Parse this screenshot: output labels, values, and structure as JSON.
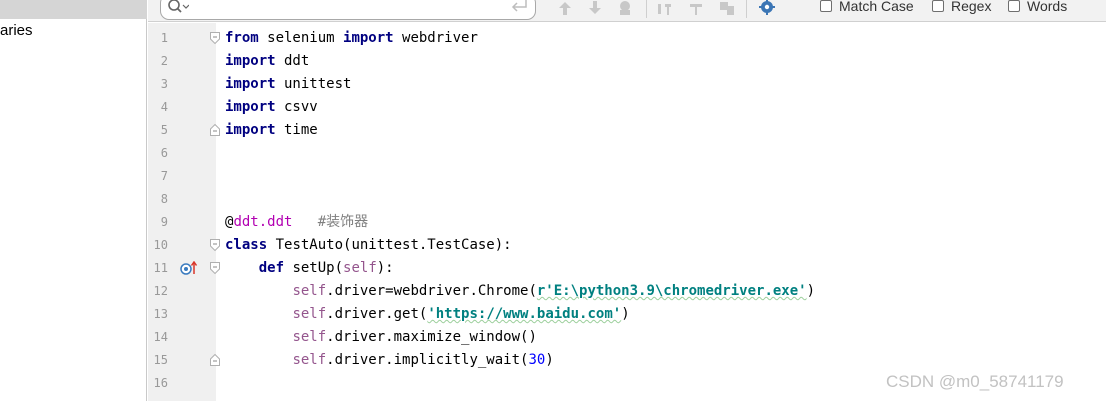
{
  "project": {
    "tree_label": "aries"
  },
  "find": {
    "search_value": "",
    "options": [
      {
        "label": "Match Case",
        "checked": false
      },
      {
        "label": "Regex",
        "checked": false
      },
      {
        "label": "Words",
        "checked": false
      }
    ]
  },
  "editor": {
    "line_numbers": [
      "1",
      "2",
      "3",
      "4",
      "5",
      "6",
      "7",
      "8",
      "9",
      "10",
      "11",
      "12",
      "13",
      "14",
      "15",
      "16"
    ],
    "code": {
      "l1_kw1": "from",
      "l1_mod": " selenium ",
      "l1_kw2": "import",
      "l1_name": " webdriver",
      "l2_kw": "import",
      "l2_name": " ddt",
      "l3_kw": "import",
      "l3_name": " unittest",
      "l4_kw": "import",
      "l4_name": " csvv",
      "l5_kw": "import",
      "l5_name": " time",
      "l9_at": "@",
      "l9_dec": "ddt.ddt",
      "l9_comment": "   #装饰器",
      "l10_kw": "class",
      "l10_rest": " TestAuto(unittest.TestCase):",
      "l11_indent": "    ",
      "l11_kw": "def",
      "l11_name": " setUp(",
      "l11_self": "self",
      "l11_end": "):",
      "l12_indent": "        ",
      "l12_self": "self",
      "l12_mid": ".driver=webdriver.Chrome(",
      "l12_str": "r'E:\\python3.9\\chromedriver.exe'",
      "l12_end": ")",
      "l13_indent": "        ",
      "l13_self": "self",
      "l13_mid": ".driver.get(",
      "l13_str": "'https://www.baidu.com'",
      "l13_end": ")",
      "l14_indent": "        ",
      "l14_self": "self",
      "l14_mid": ".driver.maximize_window()",
      "l15_indent": "        ",
      "l15_self": "self",
      "l15_mid": ".driver.implicitly_wait(",
      "l15_num": "30",
      "l15_end": ")"
    }
  },
  "watermark": "CSDN @m0_58741179",
  "colors": {
    "keyword": "#000080",
    "self": "#94558d",
    "string": "#008080",
    "number": "#0000ff",
    "comment": "#808080",
    "decorator": "#b200b2",
    "gutter_bg": "#f0f0f0"
  },
  "icons": [
    "search-icon",
    "enter-icon",
    "arrow-up-icon",
    "arrow-down-icon",
    "find-all-icon",
    "add-occurrence-icon",
    "remove-occurrence-icon",
    "select-all-occurrences-icon",
    "settings-gear-icon",
    "fold-icon",
    "override-marker-icon"
  ]
}
